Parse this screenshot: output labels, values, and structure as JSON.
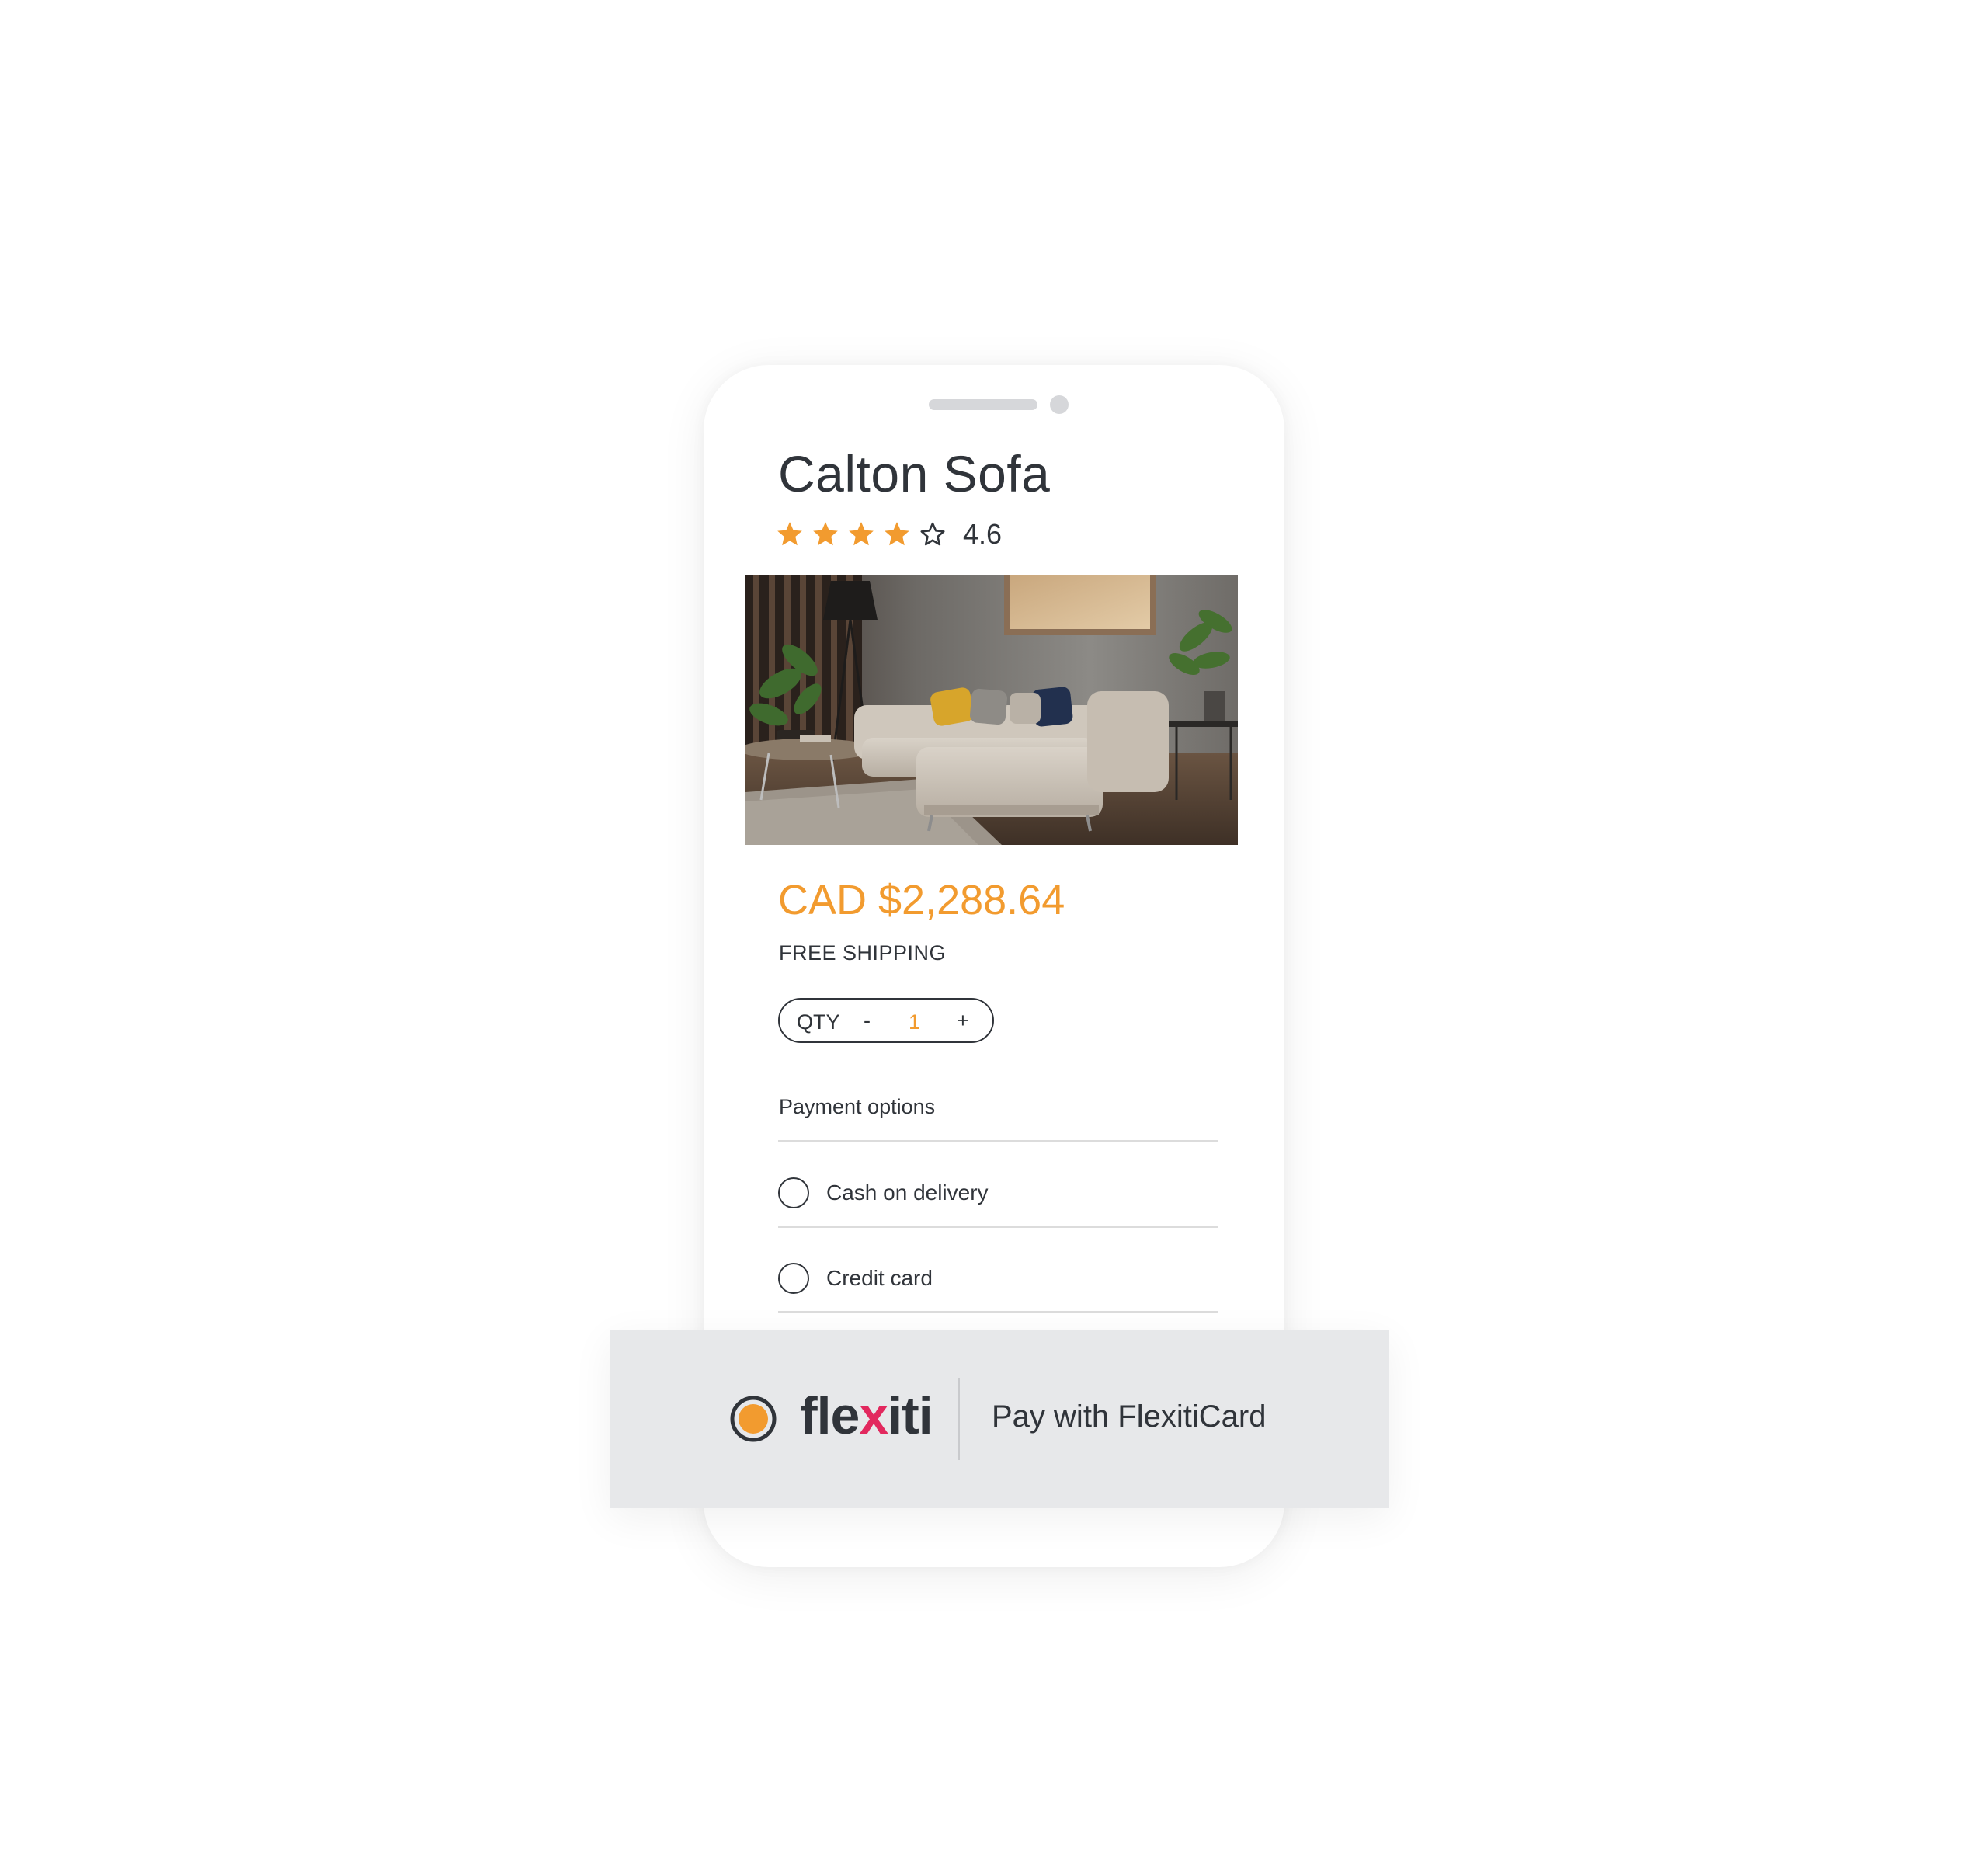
{
  "product": {
    "title": "Calton Sofa",
    "rating": 4.6,
    "rating_label": "4.6",
    "stars_filled": 4,
    "stars_total": 5,
    "image_icon": "sofa-living-room-photo",
    "price": "CAD $2,288.64",
    "shipping": "FREE SHIPPING"
  },
  "quantity": {
    "label": "QTY",
    "decrement": "-",
    "value": "1",
    "increment": "+"
  },
  "payment": {
    "title": "Payment options",
    "options": [
      {
        "label": "Cash on delivery",
        "selected": false
      },
      {
        "label": "Credit card",
        "selected": false
      }
    ]
  },
  "flexiti": {
    "brand_prefix": "fle",
    "brand_x": "x",
    "brand_suffix": "iti",
    "cta": "Pay with FlexitiCard"
  },
  "colors": {
    "accent": "#f29b2f",
    "text": "#30343a",
    "brand_x": "#e2285e",
    "bar_background": "#e7e8ea"
  }
}
